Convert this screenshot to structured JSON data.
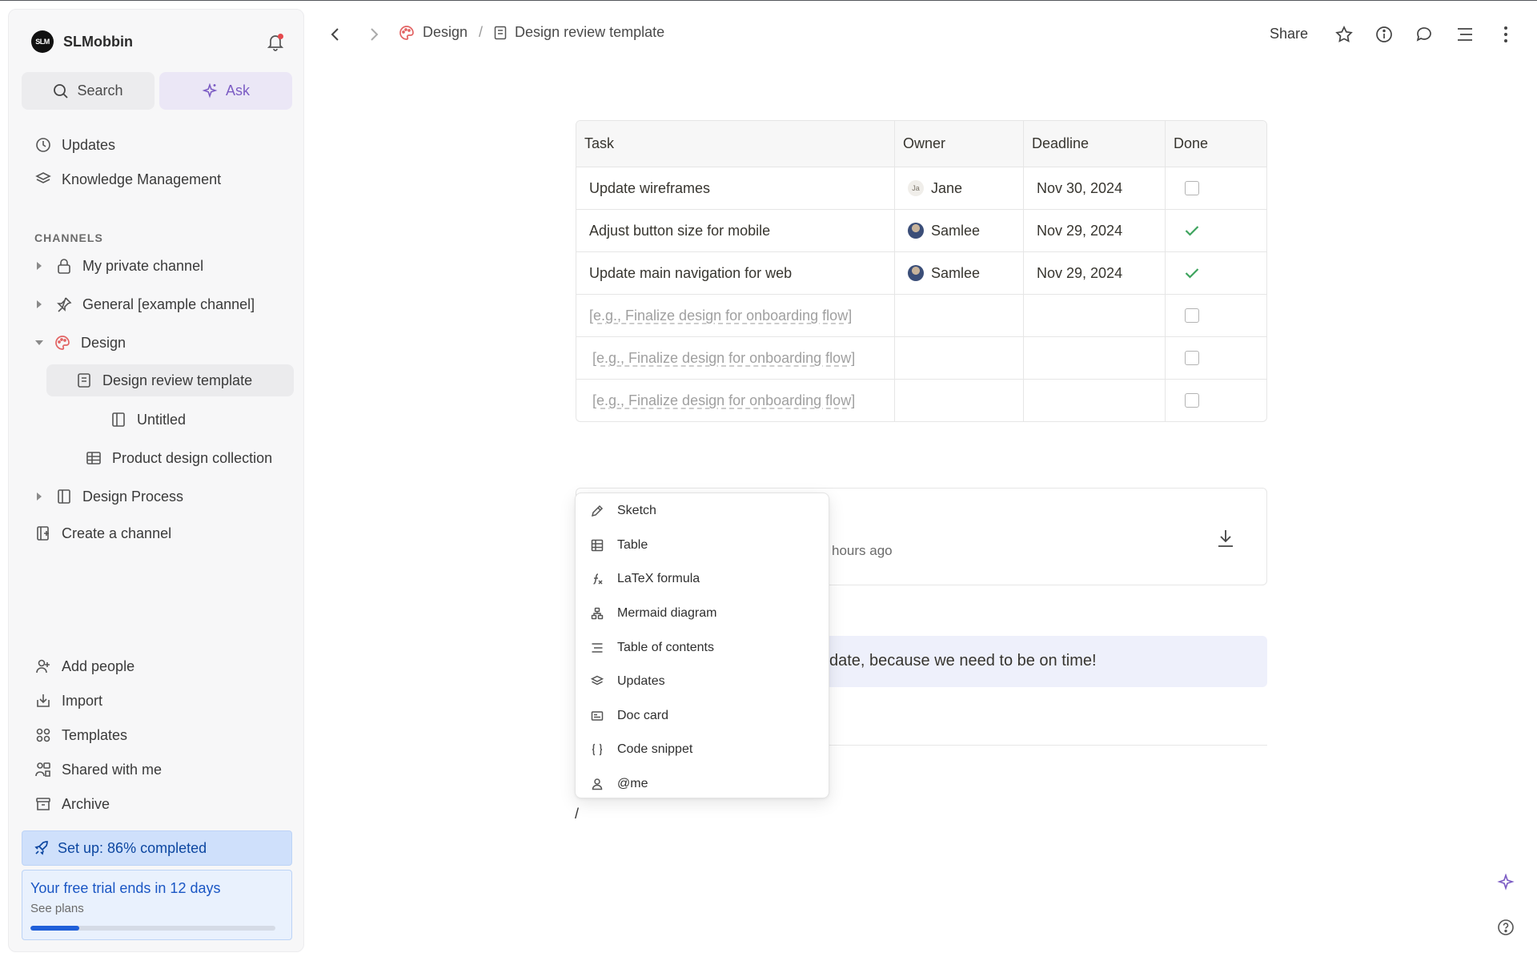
{
  "workspace": {
    "logo_text": "SLM",
    "name": "SLMobbin"
  },
  "sidebar": {
    "search_label": "Search",
    "ask_label": "Ask",
    "updates_label": "Updates",
    "knowledge_label": "Knowledge Management",
    "channels_heading": "CHANNELS",
    "channels": [
      {
        "label": "My private channel"
      },
      {
        "label": "General [example channel]"
      },
      {
        "label": "Design"
      },
      {
        "label": "Design review template"
      },
      {
        "label": "Untitled"
      },
      {
        "label": "Product design collection"
      },
      {
        "label": "Design Process"
      }
    ],
    "create_channel_label": "Create a channel",
    "bottom": [
      {
        "label": "Add people"
      },
      {
        "label": "Import"
      },
      {
        "label": "Templates"
      },
      {
        "label": "Shared with me"
      },
      {
        "label": "Archive"
      }
    ],
    "setup_label": "Set up: 86% completed",
    "setup_percent": 86,
    "trial_text": "Your free trial ends in 12 days",
    "trial_link": "See plans",
    "trial_progress": 0.2
  },
  "topbar": {
    "breadcrumb": [
      "Design",
      "Design review template"
    ],
    "breadcrumb_sep": "/",
    "share_label": "Share"
  },
  "table": {
    "headers": [
      "Task",
      "Owner",
      "Deadline",
      "Done"
    ],
    "rows": [
      {
        "task": "Update wireframes",
        "owner": "Jane",
        "owner_initials": "Ja",
        "deadline": "Nov 30, 2024",
        "done": false
      },
      {
        "task": "Adjust button size for mobile",
        "owner": "Samlee",
        "deadline": "Nov 29, 2024",
        "done": true
      },
      {
        "task": "Update main navigation for web",
        "owner": "Samlee",
        "deadline": "Nov 29, 2024",
        "done": true
      },
      {
        "task": "[e.g., Finalize design for onboarding flow]",
        "owner": "",
        "deadline": "",
        "done": false
      },
      {
        "task": "[e.g., Finalize design for onboarding flow]",
        "owner": "",
        "deadline": "",
        "done": false
      },
      {
        "task": "[e.g., Finalize design for onboarding flow]",
        "owner": "",
        "deadline": "",
        "done": false
      }
    ]
  },
  "doc_card": {
    "meta_fragment": "hours ago"
  },
  "callout": {
    "text_fragment": "date, because we need to be on time!"
  },
  "editor": {
    "slash": "/"
  },
  "insert_menu": {
    "items": [
      {
        "label": "Sketch",
        "icon": "pencil-icon"
      },
      {
        "label": "Table",
        "icon": "table-icon"
      },
      {
        "label": "LaTeX formula",
        "icon": "formula-icon"
      },
      {
        "label": "Mermaid diagram",
        "icon": "diagram-icon"
      },
      {
        "label": "Table of contents",
        "icon": "toc-icon"
      },
      {
        "label": "Updates",
        "icon": "layers-icon"
      },
      {
        "label": "Doc card",
        "icon": "doc-card-icon"
      },
      {
        "label": "Code snippet",
        "icon": "code-icon"
      },
      {
        "label": "@me",
        "icon": "person-icon"
      }
    ]
  },
  "colors": {
    "accent_purple": "#7c5cc4",
    "setup_blue": "#0d47a1",
    "check_green": "#3da35d",
    "design_icon_red": "#e26363"
  }
}
